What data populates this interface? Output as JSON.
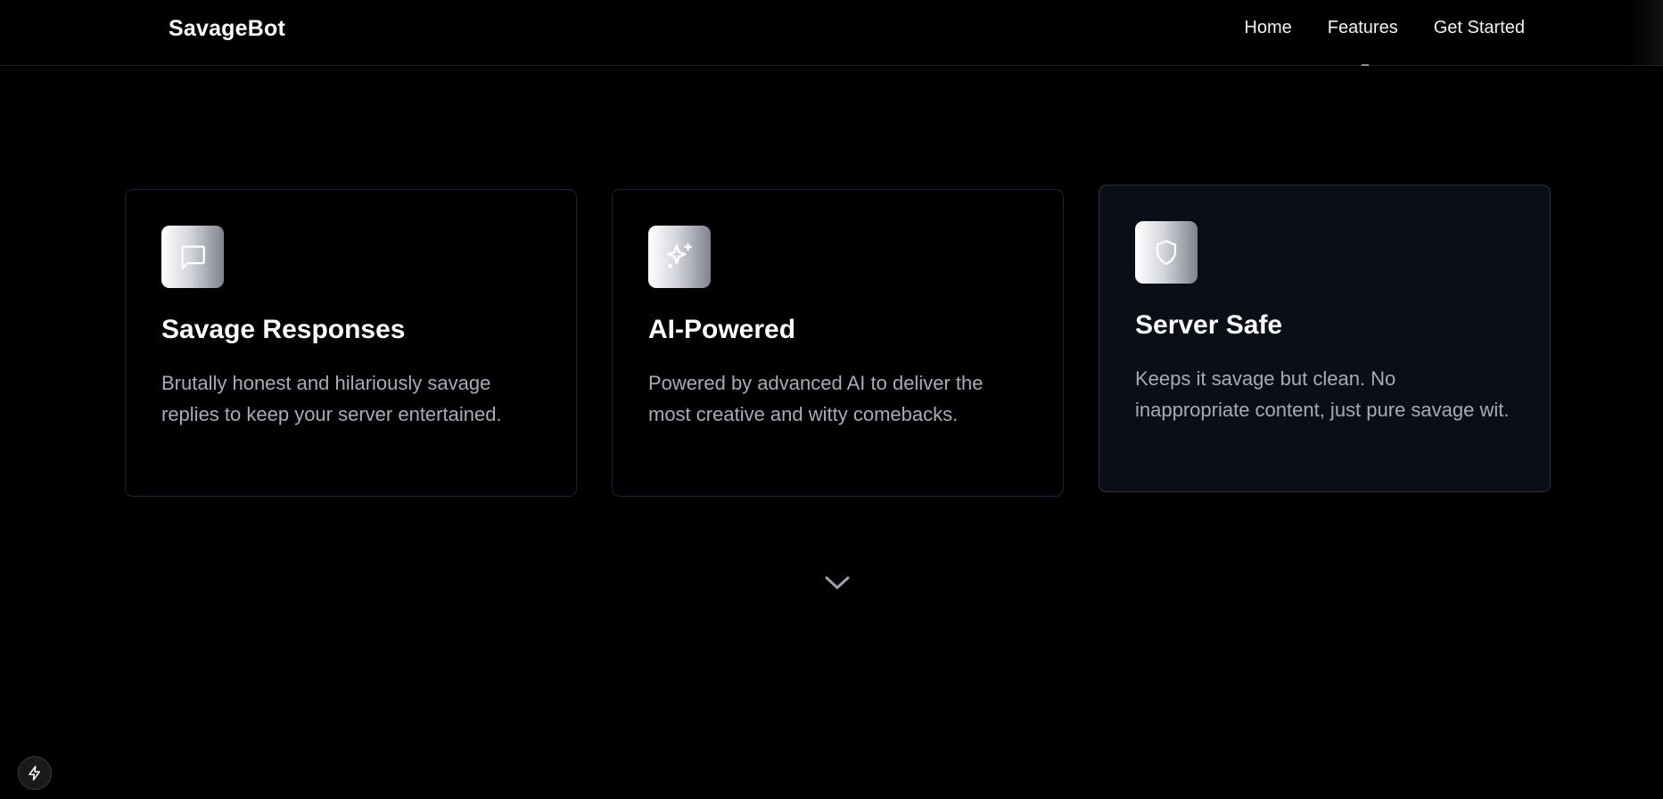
{
  "navbar": {
    "brand": "SavageBot",
    "links": [
      {
        "label": "Home"
      },
      {
        "label": "Features"
      },
      {
        "label": "Get Started"
      }
    ]
  },
  "features": [
    {
      "icon": "chat-bubble-icon",
      "title": "Savage Responses",
      "description": "Brutally honest and hilariously savage replies to keep your server entertained."
    },
    {
      "icon": "sparkles-icon",
      "title": "AI-Powered",
      "description": "Powered by advanced AI to deliver the most creative and witty comebacks."
    },
    {
      "icon": "shield-icon",
      "title": "Server Safe",
      "description": "Keeps it savage but clean. No inappropriate content, just pure savage wit."
    }
  ],
  "scroll_indicator": {
    "icon": "chevron-down-icon"
  },
  "dev_badge": {
    "icon": "lightning-icon"
  },
  "colors": {
    "background": "#000000",
    "card_border": "#1e2230",
    "card_hover_bg": "#0b0e17",
    "description_text": "#a7abb8",
    "icon_gradient_start": "#ffffff",
    "icon_gradient_end": "#7f8390"
  }
}
